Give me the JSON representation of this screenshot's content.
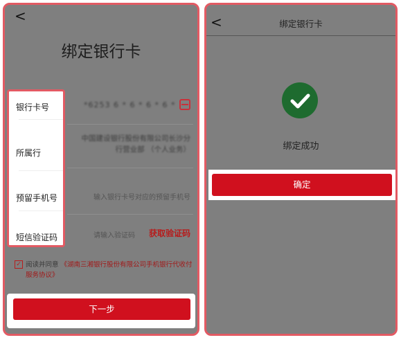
{
  "left": {
    "back_glyph": "<",
    "title": "绑定银行卡",
    "fields": [
      {
        "label": "银行卡号",
        "value": "*6253 6 * 6 * 6 * 6 * 5 3"
      },
      {
        "label": "所属行",
        "value": "中国建设银行股份有限公司长沙分行营业部 （个人业务）"
      },
      {
        "label": "预留手机号",
        "placeholder": "输入银行卡号对应的预留手机号"
      },
      {
        "label": "短信验证码",
        "placeholder": "请输入验证码",
        "action": "获取验证码"
      }
    ],
    "agreement": {
      "checked_glyph": "✓",
      "prefix": "阅读并同意",
      "link_line1": "《湖南三湘银行股份有限公司手机银行代收付",
      "link_line2": "服务协议》"
    },
    "next_label": "下一步"
  },
  "right": {
    "back_glyph": "<",
    "title": "绑定银行卡",
    "success_text": "绑定成功",
    "confirm_label": "确定",
    "success_color": "#1e6b2f"
  },
  "colors": {
    "accent_red": "#d0101e",
    "highlight_border": "#e25a63",
    "overlay_gray": "#7f7f7f"
  }
}
